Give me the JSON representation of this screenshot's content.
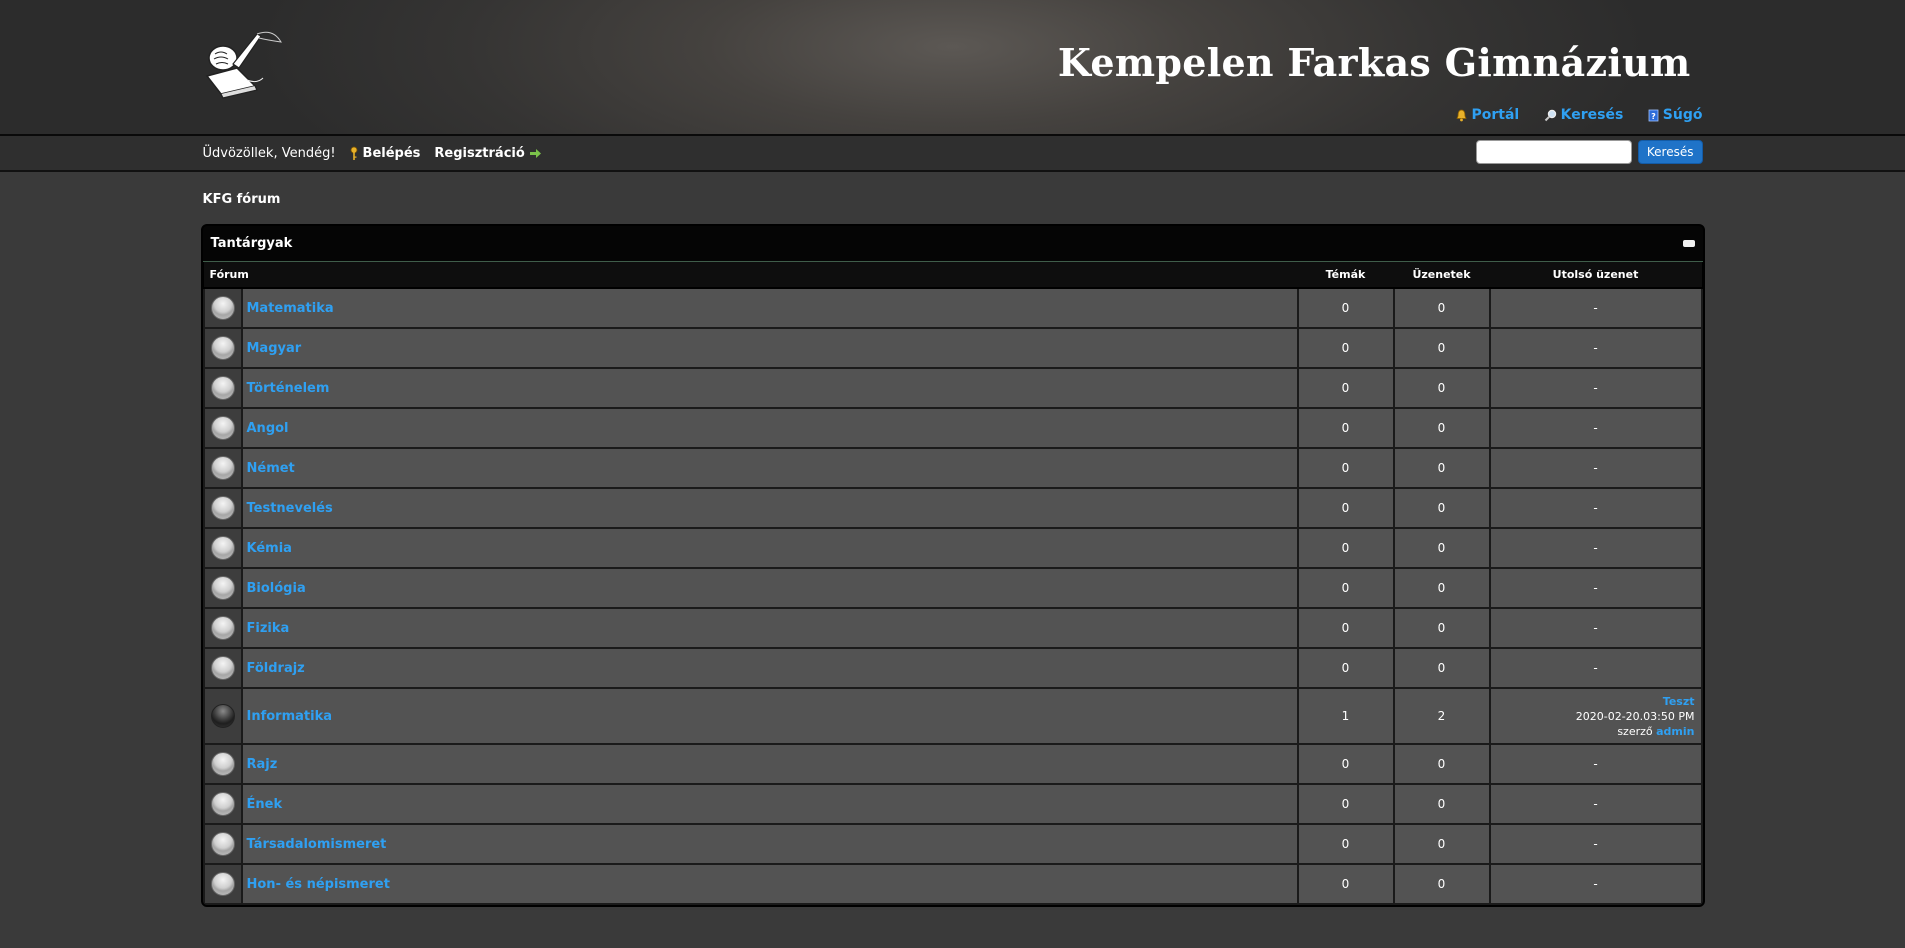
{
  "header": {
    "site_title": "Kempelen Farkas Gimnázium",
    "links": [
      "Portál",
      "Keresés",
      "Súgó"
    ]
  },
  "panel": {
    "welcome": "Üdvözöllek, Vendég!",
    "login": "Belépés",
    "register": "Regisztráció",
    "search_button": "Keresés"
  },
  "breadcrumb": "KFG fórum",
  "category": {
    "title": "Tantárgyak",
    "columns": [
      "Fórum",
      "Témák",
      "Üzenetek",
      "Utolsó üzenet"
    ],
    "forums": [
      {
        "name": "Matematika",
        "topics": "0",
        "posts": "0",
        "last": "-"
      },
      {
        "name": "Magyar",
        "topics": "0",
        "posts": "0",
        "last": "-"
      },
      {
        "name": "Történelem",
        "topics": "0",
        "posts": "0",
        "last": "-"
      },
      {
        "name": "Angol",
        "topics": "0",
        "posts": "0",
        "last": "-"
      },
      {
        "name": "Német",
        "topics": "0",
        "posts": "0",
        "last": "-"
      },
      {
        "name": "Testnevelés",
        "topics": "0",
        "posts": "0",
        "last": "-"
      },
      {
        "name": "Kémia",
        "topics": "0",
        "posts": "0",
        "last": "-"
      },
      {
        "name": "Biológia",
        "topics": "0",
        "posts": "0",
        "last": "-"
      },
      {
        "name": "Fizika",
        "topics": "0",
        "posts": "0",
        "last": "-"
      },
      {
        "name": "Földrajz",
        "topics": "0",
        "posts": "0",
        "last": "-"
      },
      {
        "name": "Informatika",
        "topics": "1",
        "posts": "2",
        "last": "",
        "last_title": "Teszt",
        "last_date": "2020-02-20.03:50 PM",
        "last_by": "szerző",
        "last_author": "admin"
      },
      {
        "name": "Rajz",
        "topics": "0",
        "posts": "0",
        "last": "-"
      },
      {
        "name": "Ének",
        "topics": "0",
        "posts": "0",
        "last": "-"
      },
      {
        "name": "Társadalomismeret",
        "topics": "0",
        "posts": "0",
        "last": "-"
      },
      {
        "name": "Hon- és népismeret",
        "topics": "0",
        "posts": "0",
        "last": "-"
      }
    ]
  }
}
